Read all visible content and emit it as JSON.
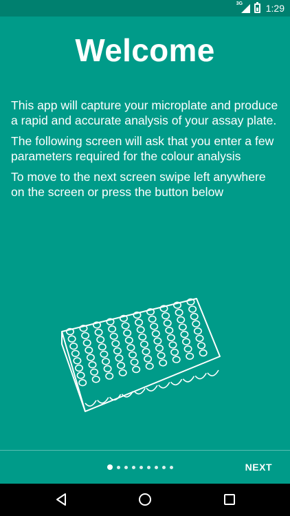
{
  "status": {
    "network_tag": "3G",
    "time": "1:29",
    "icons": [
      "signal-icon",
      "battery-icon"
    ]
  },
  "title": "Welcome",
  "paragraphs": [
    "This app will capture your microplate and produce a rapid and accurate analysis of your assay plate.",
    "The following screen will ask that you enter a few parameters required for the colour analysis",
    "To move to the next screen swipe left anywhere on the screen or press the button below"
  ],
  "pager": {
    "current_page": 1,
    "total_pages": 9
  },
  "next_label": "NEXT",
  "nav": {
    "icons": [
      "back-icon",
      "home-icon",
      "recents-icon"
    ]
  },
  "colors": {
    "background": "#009b89",
    "status_bar": "#00806f",
    "nav_bar": "#000000",
    "text": "#ffffff"
  }
}
